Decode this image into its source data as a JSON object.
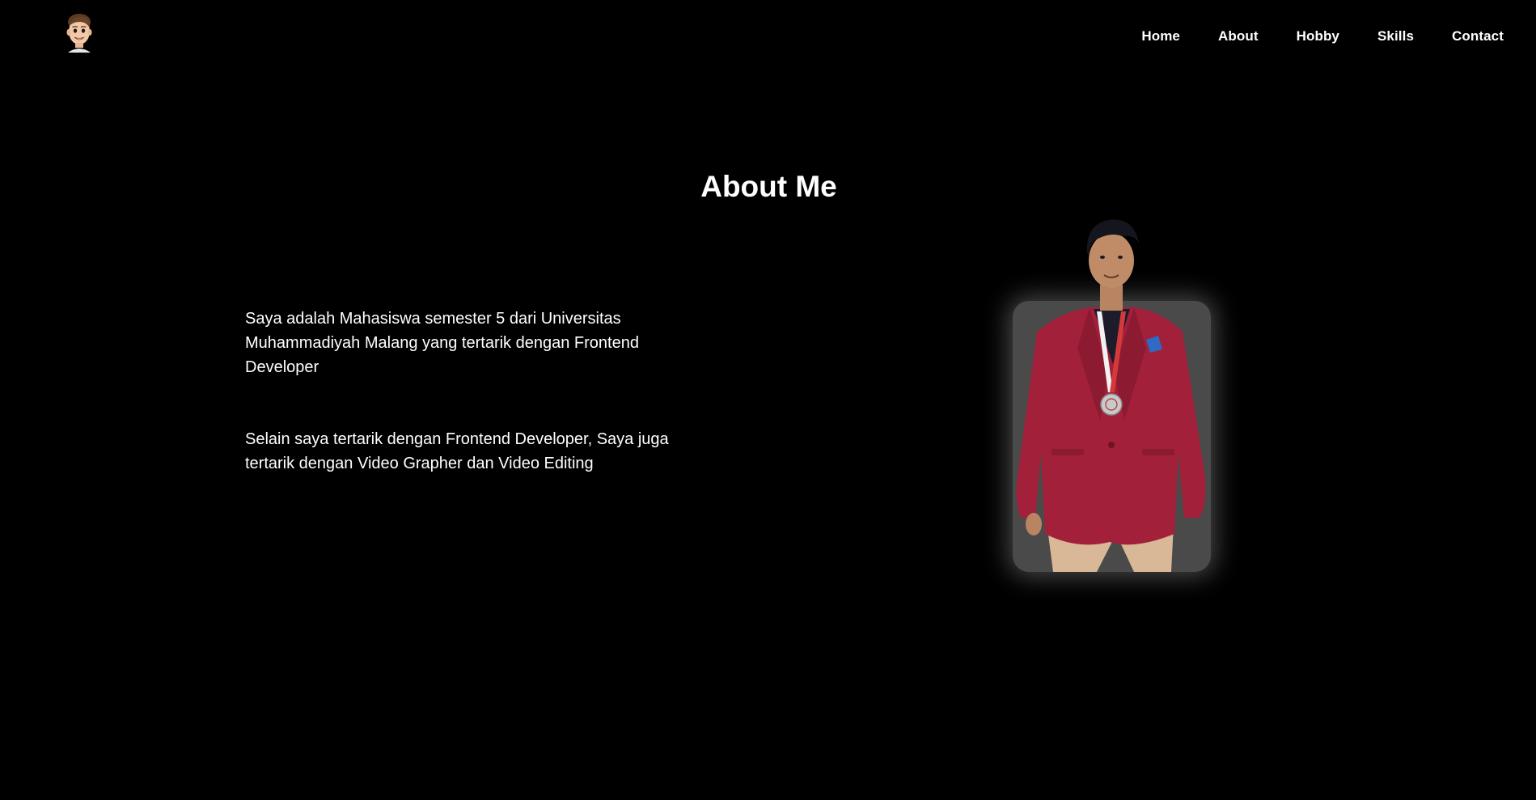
{
  "logo": {
    "icon": "memoji-avatar-icon"
  },
  "nav": {
    "items": [
      {
        "label": "Home"
      },
      {
        "label": "About"
      },
      {
        "label": "Hobby"
      },
      {
        "label": "Skills"
      },
      {
        "label": "Contact"
      }
    ]
  },
  "about": {
    "title": "About Me",
    "paragraphs": [
      "Saya adalah Mahasiswa semester 5 dari Universitas Muhammadiyah Malang yang tertarik dengan Frontend Developer",
      "Selain saya tertarik dengan Frontend Developer, Saya juga tertarik dengan Video Grapher dan Video Editing"
    ]
  },
  "colors": {
    "background": "#000000",
    "text": "#ffffff",
    "photo_card": "#4a4a4a",
    "jacket": "#a3203b"
  }
}
